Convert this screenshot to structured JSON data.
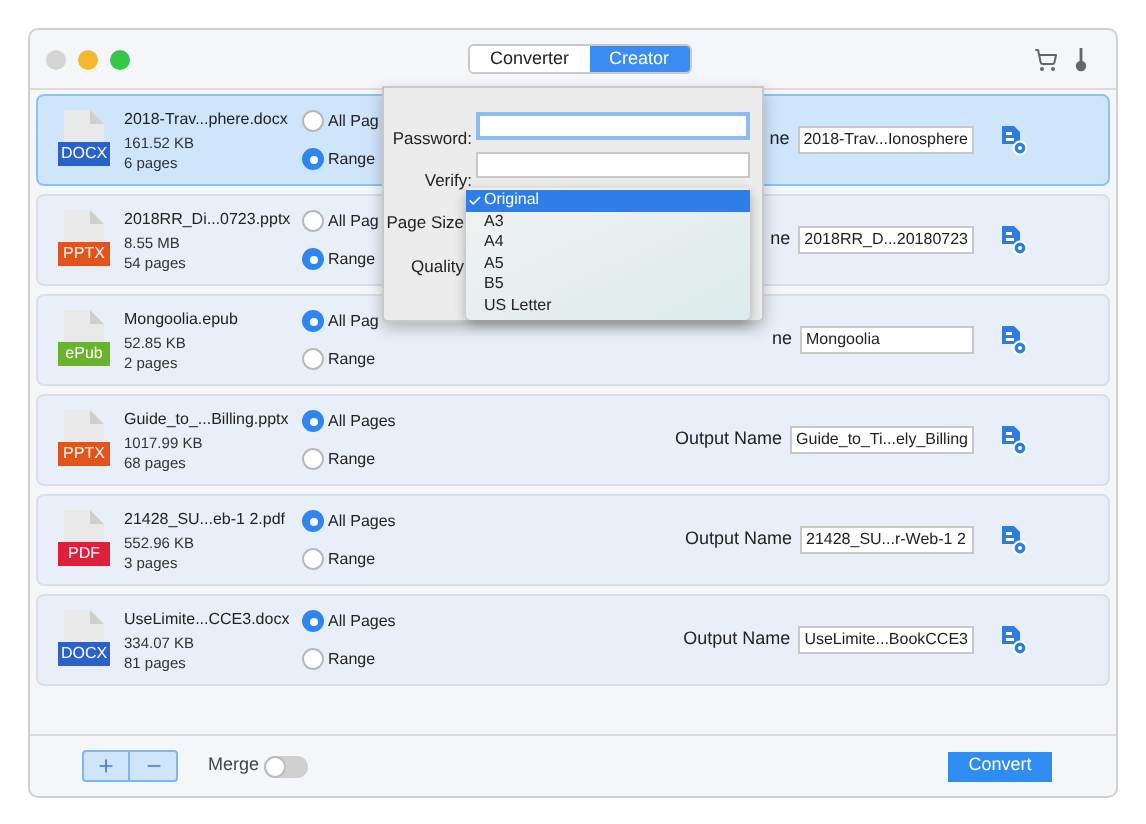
{
  "tabs": [
    {
      "label": "Converter",
      "selected": false
    },
    {
      "label": "Creator",
      "selected": true
    }
  ],
  "files": [
    {
      "name": "2018-Trav...phere.docx",
      "size": "161.52 KB",
      "pages": "6 pages",
      "type_label": "DOCX",
      "color": "#2a62c9",
      "selected": true,
      "options": [
        {
          "label": "All Pag",
          "selected": false
        },
        {
          "label": "Range",
          "selected": true
        }
      ],
      "output_label": "ne",
      "output_name": "2018-Trav...Ionosphere"
    },
    {
      "name": "2018RR_Di...0723.pptx",
      "size": "8.55 MB",
      "pages": "54 pages",
      "type_label": "PPTX",
      "color": "#e3541c",
      "selected": false,
      "options": [
        {
          "label": "All Pag",
          "selected": false
        },
        {
          "label": "Range",
          "selected": true
        }
      ],
      "output_label": "ne",
      "output_name": "2018RR_D...20180723"
    },
    {
      "name": "Mongoolia.epub",
      "size": "52.85 KB",
      "pages": "2 pages",
      "type_label": "ePub",
      "color": "#6ab42d",
      "selected": false,
      "options": [
        {
          "label": "All Pag",
          "selected": true
        },
        {
          "label": "Range",
          "selected": false
        }
      ],
      "output_label": "ne",
      "output_name": "Mongoolia"
    },
    {
      "name": "Guide_to_...Billing.pptx",
      "size": "1017.99 KB",
      "pages": "68 pages",
      "type_label": "PPTX",
      "color": "#e3541c",
      "selected": false,
      "options": [
        {
          "label": "All Pages",
          "selected": true
        },
        {
          "label": "Range",
          "selected": false
        }
      ],
      "output_label": "Output Name",
      "output_name": "Guide_to_Ti...ely_Billing"
    },
    {
      "name": "21428_SU...eb-1 2.pdf",
      "size": "552.96 KB",
      "pages": "3 pages",
      "type_label": "PDF",
      "color": "#e0203a",
      "selected": false,
      "options": [
        {
          "label": "All Pages",
          "selected": true
        },
        {
          "label": "Range",
          "selected": false
        }
      ],
      "output_label": "Output Name",
      "output_name": "21428_SU...r-Web-1 2"
    },
    {
      "name": "UseLimite...CCE3.docx",
      "size": "334.07 KB",
      "pages": "81 pages",
      "type_label": "DOCX",
      "color": "#2a62c9",
      "selected": false,
      "options": [
        {
          "label": "All Pages",
          "selected": true
        },
        {
          "label": "Range",
          "selected": false
        }
      ],
      "output_label": "Output Name",
      "output_name": "UseLimite...BookCCE3"
    }
  ],
  "popover": {
    "password_label": "Password:",
    "verify_label": "Verify:",
    "page_size_label": "Page Size",
    "quality_label": "Quality",
    "page_size_menu": [
      {
        "label": "Original",
        "selected": true
      },
      {
        "label": "A3",
        "selected": false
      },
      {
        "label": "A4",
        "selected": false
      },
      {
        "label": "A5",
        "selected": false
      },
      {
        "label": "B5",
        "selected": false
      },
      {
        "label": "US Letter",
        "selected": false
      }
    ]
  },
  "footer": {
    "merge": {
      "label": "Merge",
      "on": false
    },
    "convert": "Convert"
  }
}
